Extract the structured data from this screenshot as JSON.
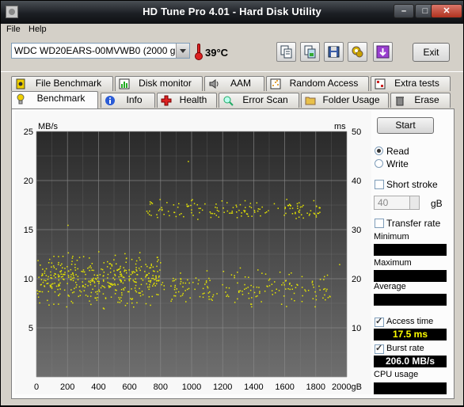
{
  "window": {
    "title": "HD Tune Pro 4.01 - Hard Disk Utility",
    "minimize_glyph": "–",
    "maximize_glyph": "□",
    "close_glyph": "✕"
  },
  "menu": {
    "items": [
      "File",
      "Help"
    ]
  },
  "toolbar": {
    "drive": "WDC WD20EARS-00MVWB0 (2000 gB)",
    "temperature": "39°C",
    "buttons": [
      "copy-info-icon",
      "copy-screenshot-icon",
      "save-icon",
      "options-icon",
      "download-icon"
    ],
    "exit_label": "Exit"
  },
  "tabs": {
    "row1": [
      {
        "label": "File Benchmark",
        "icon": "file-benchmark-icon"
      },
      {
        "label": "Disk monitor",
        "icon": "disk-monitor-icon"
      },
      {
        "label": "AAM",
        "icon": "speaker-icon"
      },
      {
        "label": "Random Access",
        "icon": "random-access-icon"
      },
      {
        "label": "Extra tests",
        "icon": "extra-tests-icon"
      }
    ],
    "row2": [
      {
        "label": "Benchmark",
        "icon": "benchmark-icon",
        "active": true
      },
      {
        "label": "Info",
        "icon": "info-icon"
      },
      {
        "label": "Health",
        "icon": "health-cross-icon"
      },
      {
        "label": "Error Scan",
        "icon": "magnifier-icon"
      },
      {
        "label": "Folder Usage",
        "icon": "folder-icon"
      },
      {
        "label": "Erase",
        "icon": "trash-icon"
      }
    ]
  },
  "side": {
    "start_label": "Start",
    "read_label": "Read",
    "write_label": "Write",
    "mode_selected": "Read",
    "short_stroke_label": "Short stroke",
    "short_stroke_checked": false,
    "short_stroke_value": "40",
    "short_stroke_unit": "gB",
    "transfer_rate_label": "Transfer rate",
    "transfer_rate_checked": false,
    "minimum_label": "Minimum",
    "minimum_value": "",
    "maximum_label": "Maximum",
    "maximum_value": "",
    "average_label": "Average",
    "average_value": "",
    "access_time_label": "Access time",
    "access_time_checked": true,
    "access_time_value": "17.5 ms",
    "burst_rate_label": "Burst rate",
    "burst_rate_checked": true,
    "burst_rate_value": "206.0 MB/s",
    "cpu_usage_label": "CPU usage",
    "cpu_usage_value": ""
  },
  "chart_data": {
    "type": "scatter",
    "left_axis_label": "MB/s",
    "right_axis_label": "ms",
    "x_unit": "gB",
    "xlim": [
      0,
      2000
    ],
    "ylim_left": [
      0,
      25
    ],
    "ylim_right": [
      0,
      50
    ],
    "x_ticks": [
      0,
      200,
      400,
      600,
      800,
      1000,
      1200,
      1400,
      1600,
      1800,
      2000
    ],
    "y_left_ticks": [
      5,
      10,
      15,
      20,
      25
    ],
    "y_right_ticks": [
      10,
      20,
      30,
      40,
      50
    ],
    "grid": true,
    "point_color": "#e6e600",
    "series": [
      {
        "name": "Access time",
        "axis": "right",
        "clusters": [
          {
            "x_range": [
              0,
              800
            ],
            "ms_center": 20,
            "ms_spread": 7,
            "count": 420
          },
          {
            "x_range": [
              800,
              1900
            ],
            "ms_center": 18,
            "ms_spread": 5,
            "count": 180
          },
          {
            "x_range": [
              700,
              1850
            ],
            "ms_center": 34,
            "ms_spread": 3,
            "count": 150
          }
        ],
        "outliers": [
          {
            "x": 975,
            "ms": 44
          },
          {
            "x": 1950,
            "ms": 23
          },
          {
            "x": 200,
            "ms": 31
          }
        ]
      }
    ]
  },
  "colors": {
    "chart_bg_top": "#2a2a2a",
    "chart_bg_bottom": "#6e6e6e",
    "grid": "#8a8a8a",
    "value_text": "#ffff00"
  }
}
